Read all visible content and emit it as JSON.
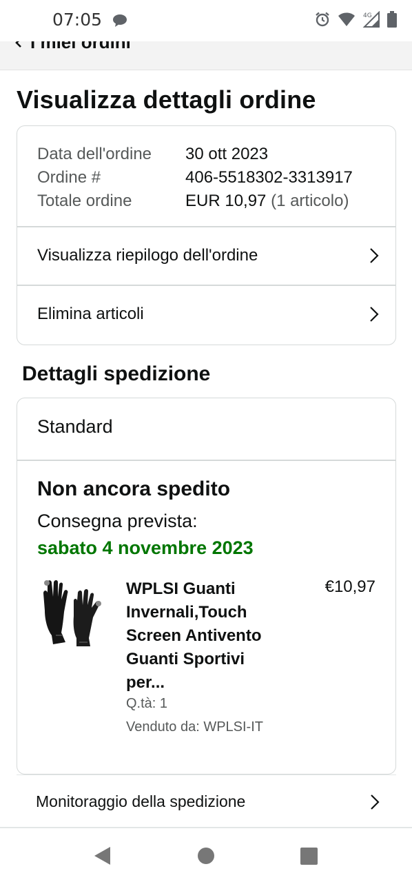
{
  "status_bar": {
    "time": "07:05",
    "icons": [
      "chat-bubble-icon",
      "alarm-icon",
      "wifi-icon",
      "network-4g-icon",
      "battery-icon"
    ],
    "network_label": "4G"
  },
  "nav": {
    "back_label": "I miei ordini"
  },
  "page": {
    "title": "Visualizza dettagli ordine"
  },
  "order": {
    "date_label": "Data dell'ordine",
    "date_value": "30 ott 2023",
    "number_label": "Ordine #",
    "number_value": "406-5518302-3313917",
    "total_label": "Totale ordine",
    "total_value": "EUR 10,97",
    "total_items": "(1 articolo)",
    "summary_link": "Visualizza riepilogo dell'ordine",
    "delete_link": "Elimina articoli"
  },
  "shipping": {
    "section_title": "Dettagli spedizione",
    "method": "Standard",
    "status": "Non ancora spedito",
    "delivery_label": "Consegna prevista:",
    "delivery_date": "sabato 4 novembre 2023",
    "product": {
      "title_lines": [
        "WPLSI Guanti",
        "Invernali,Touch",
        "Screen Antivento",
        "Guanti Sportivi",
        "per..."
      ],
      "price": "€10,97",
      "quantity": "Q.tà: 1",
      "seller": "Venduto da: WPLSI-IT",
      "image_icon": "gloves-image"
    },
    "tracking_link": "Monitoraggio della spedizione"
  },
  "colors": {
    "delivery_green": "#007600",
    "border": "#d5d9d9",
    "muted_text": "#565959",
    "text": "#0f1111"
  },
  "android_nav": {
    "icons": [
      "back-triangle-icon",
      "home-circle-icon",
      "recents-square-icon"
    ]
  }
}
